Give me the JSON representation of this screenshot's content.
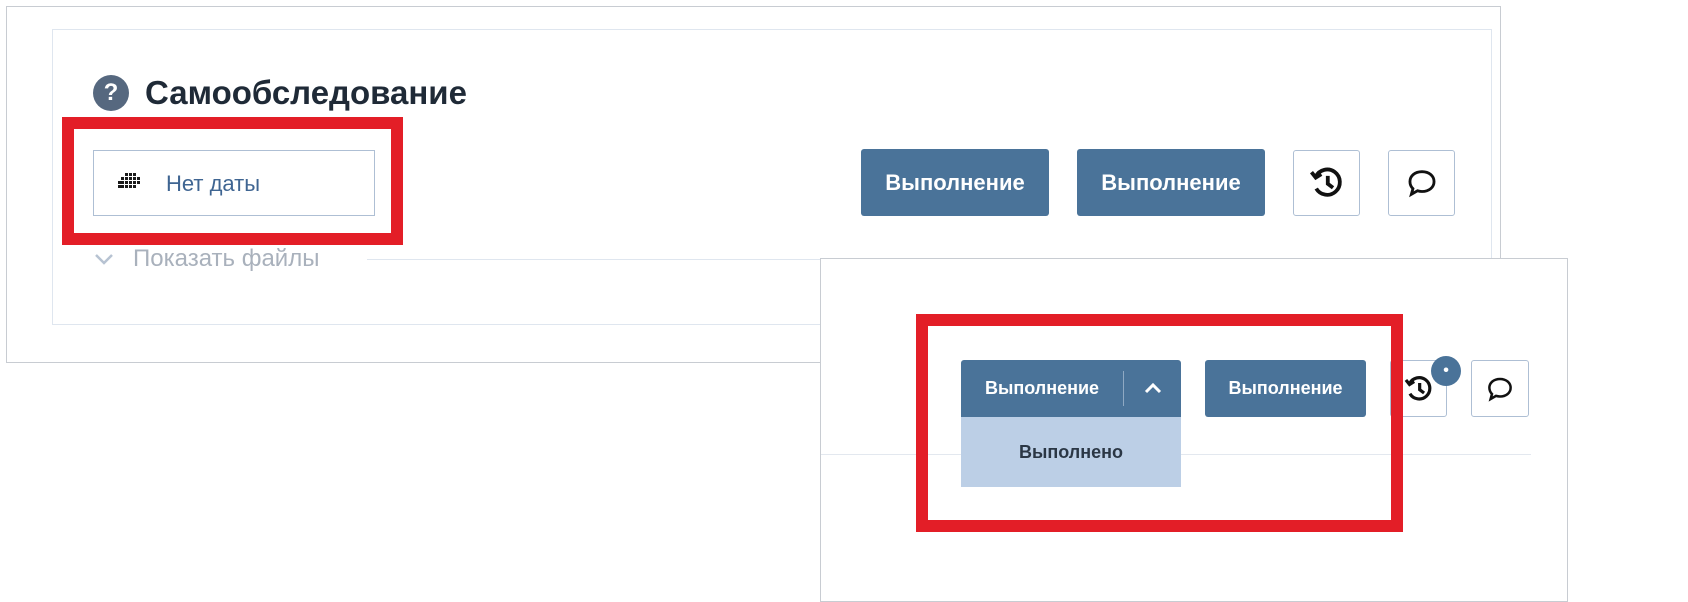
{
  "colors": {
    "accent_blue": "#4a7399",
    "highlight_red": "#e31e27",
    "dropdown_bg": "#bccfe6",
    "muted_text": "#a9b1bc",
    "title_text": "#1f2a37"
  },
  "panel1": {
    "help_icon_glyph": "?",
    "title": "Самообследование",
    "date_field": {
      "text": "Нет даты",
      "icon": "calendar-icon"
    },
    "buttons": {
      "execution_1": "Выполнение",
      "execution_2": "Выполнение",
      "history_icon": "history-icon",
      "comment_icon": "comment-icon"
    },
    "show_files": {
      "label": "Показать файлы",
      "icon": "chevron-down-icon"
    }
  },
  "panel2": {
    "split_button": {
      "label": "Выполнение",
      "toggle_icon": "chevron-up-icon",
      "dropdown_items": [
        "Выполнено"
      ]
    },
    "execution_button": "Выполнение",
    "history_badge": "•",
    "history_icon": "history-icon",
    "comment_icon": "comment-icon"
  }
}
